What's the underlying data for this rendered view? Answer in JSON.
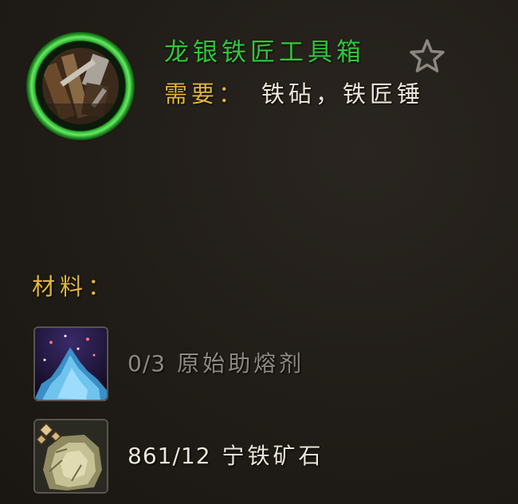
{
  "recipe": {
    "title": "龙银铁匠工具箱",
    "title_color": "#2fc63a",
    "favorite_icon": "star-outline-icon",
    "requires_label": "需要：",
    "requires_value": "铁砧，铁匠锤"
  },
  "materials": {
    "header": "材料：",
    "items": [
      {
        "count": "0/3",
        "name": "原始助熔剂",
        "icon": "primal-flux-icon",
        "text_color": "#8d8881"
      },
      {
        "count": "861/12",
        "name": "宁铁矿石",
        "icon": "serevite-ore-icon",
        "text_color": "#ece6d8"
      }
    ]
  },
  "colors": {
    "background": "#201c17",
    "label_gold": "#e0b63a",
    "ring_green": "#2db52d"
  }
}
